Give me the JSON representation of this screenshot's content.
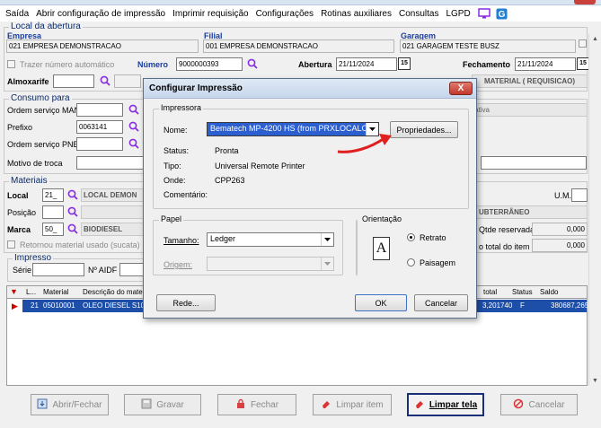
{
  "menu": [
    "Saída",
    "Abrir configuração de impressão",
    "Imprimir requisição",
    "Configurações",
    "Rotinas auxiliares",
    "Consultas",
    "LGPD"
  ],
  "abertura": {
    "group_label": "Local da abertura",
    "empresa_label": "Empresa",
    "empresa_value": "021 EMPRESA DEMONSTRACAO",
    "filial_label": "Filial",
    "filial_value": "001 EMPRESA DEMONSTRACAO",
    "garagem_label": "Garagem",
    "garagem_value": "021 GARAGEM TESTE BUSZ",
    "trazer_label": "Trazer número automático",
    "numero_label": "Número",
    "numero_value": "9000000393",
    "abertura_label": "Abertura",
    "abertura_value": "21/11/2024",
    "fechamento_label": "Fechamento",
    "fechamento_value": "21/11/2024",
    "almoxarife_label": "Almoxarife",
    "status_text": "MATERIAL ( REQUISICAO)"
  },
  "consumo": {
    "group_label": "Consumo para",
    "os_man_label": "Ordem serviço MAN",
    "prefixo_label": "Prefixo",
    "prefixo_value": "0063141",
    "os_pne_label": "Ordem serviço PNE",
    "motivo_label": "Motivo de troca",
    "ativa_text": "ativa"
  },
  "materiais": {
    "group_label": "Materiais",
    "local_label": "Local",
    "local_code": "21_",
    "local_name": "LOCAL DEMON",
    "posicao_label": "Posição",
    "marca_label": "Marca",
    "marca_code": "50_",
    "marca_name": "BIODIESEL",
    "retornou_label": "Retornou material usado (sucata)",
    "um_label": "U.M.",
    "subterraneo_text": "UBTERRÂNEO",
    "qtde_label": "Qtde reservada",
    "qtde_value": "0,000",
    "total_label": "o total do item",
    "total_value": "0,000"
  },
  "impresso": {
    "group_label": "Impresso",
    "serie_label": "Série",
    "aidf_label": "Nº AIDF"
  },
  "table": {
    "headers": [
      "L...",
      "Material",
      "Descrição do mate",
      "total",
      "Status",
      "Saldo"
    ],
    "row": [
      "21",
      "05010001",
      "OLEO DIESEL S10",
      "3,201740",
      "F",
      "380687,265"
    ]
  },
  "bottom_buttons": [
    {
      "label": "Abrir/Fechar"
    },
    {
      "label": "Gravar"
    },
    {
      "label": "Fechar"
    },
    {
      "label": "Limpar item"
    },
    {
      "label": "Limpar tela"
    },
    {
      "label": "Cancelar"
    }
  ],
  "dialog": {
    "title": "Configurar Impressão",
    "close": "X",
    "impressora_group": "Impressora",
    "nome_label": "Nome:",
    "nome_value": "Bematech MP-4200 HS (from PRXLOCALO",
    "propriedades_btn": "Propriedades...",
    "status_label": "Status:",
    "status_value": "Pronta",
    "tipo_label": "Tipo:",
    "tipo_value": "Universal Remote Printer",
    "onde_label": "Onde:",
    "onde_value": "CPP263",
    "comentario_label": "Comentário:",
    "papel_group": "Papel",
    "tamanho_label": "Tamanho:",
    "tamanho_value": "Ledger",
    "origem_label": "Origem:",
    "orientacao_group": "Orientação",
    "retrato_label": "Retrato",
    "paisagem_label": "Paisagem",
    "orient_icon": "A",
    "rede_btn": "Rede...",
    "ok_btn": "OK",
    "cancelar_btn": "Cancelar"
  }
}
